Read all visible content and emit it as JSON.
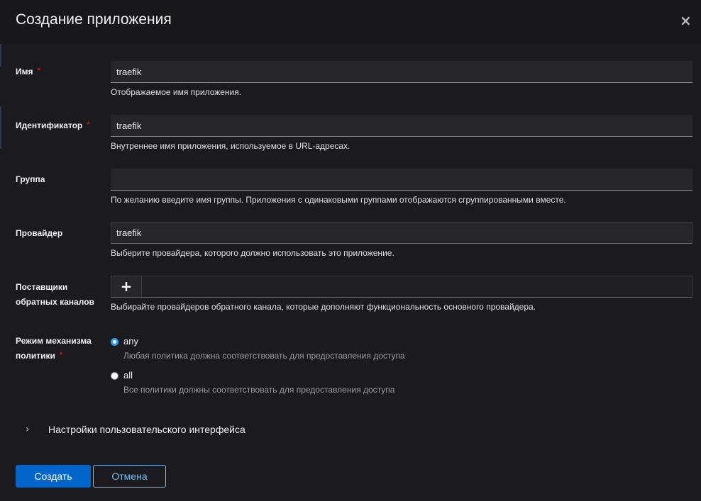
{
  "modal": {
    "title": "Создание приложения",
    "close_symbol": "×"
  },
  "fields": {
    "name": {
      "label": "Имя",
      "required_mark": "*",
      "value": "traefik",
      "helper": "Отображаемое имя приложения."
    },
    "slug": {
      "label": "Идентификатор",
      "required_mark": "*",
      "value": "traefik",
      "helper": "Внутреннее имя приложения, используемое в URL-адресах."
    },
    "group": {
      "label": "Группа",
      "value": "",
      "helper": "По желанию введите имя группы. Приложения с одинаковыми группами отображаются сгруппированными вместе."
    },
    "provider": {
      "label": "Провайдер",
      "value": "traefik",
      "helper": "Выберите провайдера, которого должно использовать это приложение."
    },
    "backchannel": {
      "label_line1": "Поставщики",
      "label_line2": "обратных каналов",
      "add_symbol": "+",
      "helper": "Выбирайте провайдеров обратного канала, которые дополняют функциональность основного провайдера."
    },
    "policy_mode": {
      "label_line1": "Режим механизма",
      "label_line2": "политики",
      "required_mark": "*",
      "options": [
        {
          "label": "any",
          "description": "Любая политика должна соответствовать для предоставления доступа",
          "checked": true
        },
        {
          "label": "all",
          "description": "Все политики должны соответствовать для предоставления доступа",
          "checked": false
        }
      ]
    }
  },
  "ui_settings": {
    "chevron": "›",
    "label": "Настройки пользовательского интерфейса"
  },
  "footer": {
    "create_label": "Создать",
    "cancel_label": "Отмена"
  },
  "colors": {
    "primary": "#0066cc",
    "link": "#73bcf7",
    "required": "#c9190b",
    "radio_checked": "#2b9af3"
  }
}
